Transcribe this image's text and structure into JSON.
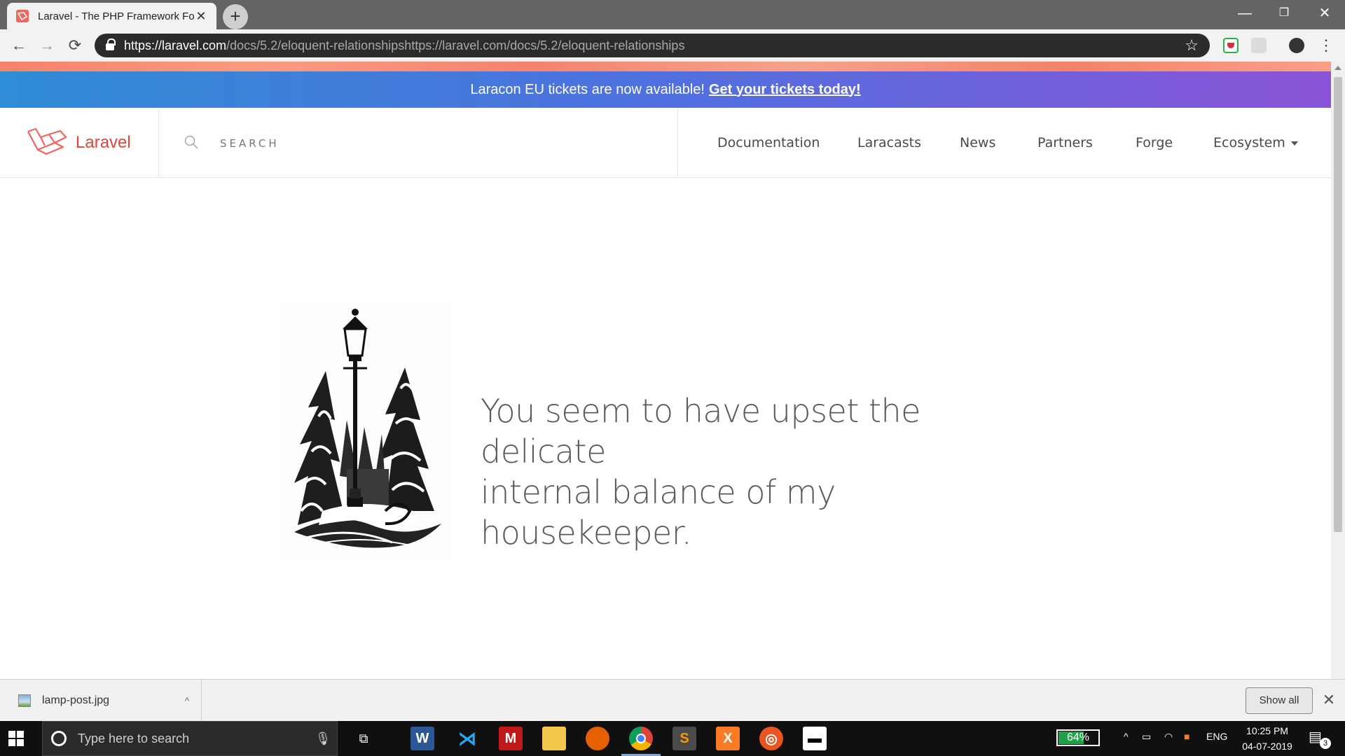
{
  "browser": {
    "tab_title": "Laravel - The PHP Framework For",
    "tab_close": "✕",
    "new_tab": "+",
    "window_controls": {
      "minimize": "—",
      "restore": "❐",
      "close": "✕"
    },
    "nav": {
      "back": "←",
      "forward": "→",
      "reload": "⟳"
    },
    "url_host": "https://laravel.com",
    "url_path": "/docs/5.2/eloquent-relationshipshttps://laravel.com/docs/5.2/eloquent-relationships",
    "bookmark_star": "☆",
    "menu": "⋮"
  },
  "page": {
    "banner_text": "Laracon EU tickets are now available!",
    "banner_link": "Get your tickets today!",
    "logo_text": "Laravel",
    "search_placeholder": "SEARCH",
    "nav_items": [
      "Documentation",
      "Laracasts",
      "News",
      "Partners",
      "Forge",
      "Ecosystem"
    ],
    "message_line1": "You seem to have upset the delicate",
    "message_line2": "internal balance of my housekeeper.",
    "brand_color": "#f4645f"
  },
  "download_shelf": {
    "file_name": "lamp-post.jpg",
    "caret": "^",
    "show_all": "Show all",
    "close": "✕"
  },
  "taskbar": {
    "search_placeholder": "Type here to search",
    "battery": "64%",
    "battery_level": 0.64,
    "language": "ENG",
    "time": "10:25 PM",
    "date": "04-07-2019",
    "notification_count": "3",
    "tray_caret": "^",
    "apps": [
      "task-view-icon",
      "word-icon",
      "vscode-icon",
      "mcafee-icon",
      "file-explorer-icon",
      "firefox-icon",
      "chrome-icon",
      "sublime-text-icon",
      "xampp-icon",
      "ubuntu-icon",
      "video-editor-icon"
    ]
  }
}
